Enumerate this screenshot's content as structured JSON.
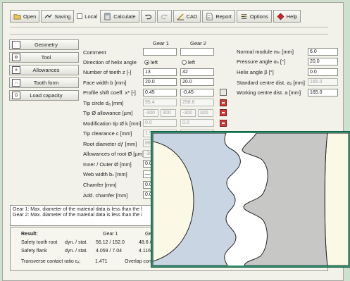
{
  "toolbar": {
    "open": "Open",
    "saving": "Saving",
    "local": "Local",
    "calculate": "Calculate",
    "cad": "CAD",
    "report": "Report",
    "options": "Options",
    "help": "Help"
  },
  "sidebar": {
    "items": [
      {
        "label": "Geometry"
      },
      {
        "label": "Tool"
      },
      {
        "label": "Allowances"
      },
      {
        "label": "Tooth form"
      },
      {
        "label": "Load capacity"
      }
    ]
  },
  "table": {
    "gear1": "Gear 1",
    "gear2": "Gear 2",
    "rows": [
      {
        "label": "Comment",
        "g1": "",
        "g2": ""
      },
      {
        "label": "Direction of helix angle",
        "g1": "left",
        "g2": "left"
      },
      {
        "label": "Number of teeth z [-]",
        "g1": "13",
        "g2": "42"
      },
      {
        "label": "Face width b [mm]",
        "g1": "20.0",
        "g2": "20.0"
      },
      {
        "label": "Profile shift coeff. x* [-]",
        "g1": "0.45",
        "g2": "-0.45"
      },
      {
        "label": "Tip circle dₐ [mm]",
        "g1": "95.4",
        "g2": "258.6"
      },
      {
        "label": "Tip Ø allowance [µm]",
        "g1a": "-300",
        "g1b": "300",
        "g2a": "-300",
        "g2b": "300"
      },
      {
        "label": "Modification tip Ø k [mm]",
        "g1": "0.0",
        "g2": "0.0"
      },
      {
        "label": "Tip clearance c [mm]",
        "g1": "1.5",
        "g2": "1.5"
      },
      {
        "label": "Root diameter dƒ [mm]",
        "g1": "88.4"
      },
      {
        "label": "Allowances of root Ø [µm]",
        "g1": "-30"
      },
      {
        "label": "Inner / Outer Ø [mm]",
        "g1": "0.0"
      },
      {
        "label": "Web width bₛ [mm]",
        "g1": "—"
      },
      {
        "label": "Chamfer [mm]",
        "g1": "0.0"
      },
      {
        "label": "Add. chamfer [mm]",
        "g1": "0.0"
      }
    ]
  },
  "right": {
    "rows": [
      {
        "label": "Normal module mₙ [mm]",
        "value": "6.0"
      },
      {
        "label": "Pressure angle αₙ [°]",
        "value": "20.0"
      },
      {
        "label": "Helix angle β [°]",
        "value": "0.0"
      },
      {
        "label": "Standard centre dist. aₔ [mm]",
        "value": "165.0"
      },
      {
        "label": "Working centre dist. a [mm]",
        "value": "165.0"
      }
    ]
  },
  "messages": [
    "Gear 1: Max. diameter of the material data is less than the l",
    "Gear 2: Max. diameter of the material data is less than the i"
  ],
  "results": {
    "title": "Result:",
    "gear1": "Gear 1",
    "gear2": "Gea",
    "tooth_root_label": "Safety tooth root",
    "tooth_root_kind": "dyn. / stat.",
    "tooth_root_g1": "56.12 / 152.0",
    "tooth_root_g2": "48.6  /",
    "flank_label": "Safety flank",
    "flank_kind": "dyn. / stat.",
    "flank_g1": "4.059 / 7.04",
    "flank_g2": "4.116  /",
    "contact_label": "Transverse contact ratio εₐ:",
    "contact_value": "1.471",
    "overlap_label": "Overlap contact"
  },
  "colors": {
    "gear_blue": "#c9d5e3",
    "gear_gray": "#c7c7c5",
    "gear_cream": "#fbf8e6",
    "popup_border": "#2e8b6a"
  }
}
